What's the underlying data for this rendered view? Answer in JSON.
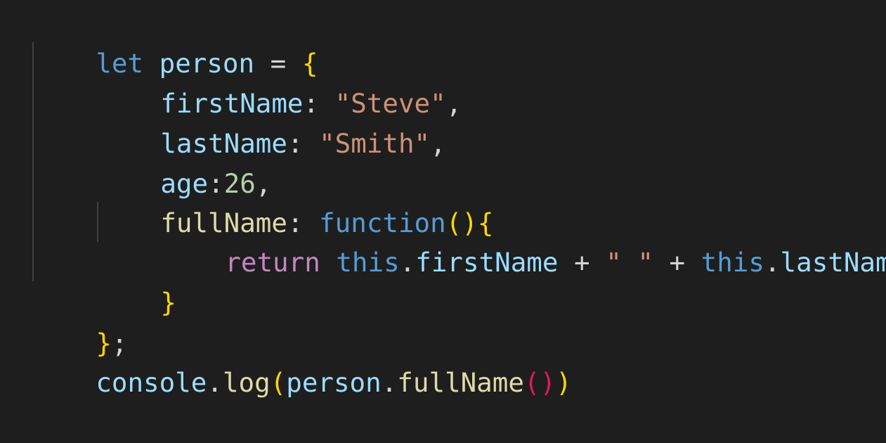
{
  "colors": {
    "background": "#1e1e1e",
    "keyword": "#569cd6",
    "variable": "#9cdcfe",
    "operator": "#d4d4d4",
    "string": "#ce9178",
    "number": "#b5cea8",
    "control": "#c586c0",
    "function": "#dcdcaa",
    "bracket_gold": "#ffd700",
    "bracket_pink": "#d81b60"
  },
  "code": {
    "line1": {
      "kw": "let",
      "sp": " ",
      "var": "person",
      "op": " = ",
      "brace": "{"
    },
    "line2": {
      "prop": "firstName",
      "colon": ": ",
      "str": "\"Steve\"",
      "comma": ","
    },
    "line3": {
      "prop": "lastName",
      "colon": ": ",
      "str": "\"Smith\"",
      "comma": ","
    },
    "line4": {
      "prop": "age",
      "colon": ":",
      "num": "26",
      "comma": ","
    },
    "line5": {
      "prop": "fullName",
      "colon": ": ",
      "kw": "function",
      "paren_open": "(",
      "paren_close": ")",
      "brace": "{"
    },
    "line6": {
      "ret": "return",
      "sp1": " ",
      "this1": "this",
      "dot1": ".",
      "prop1": "firstName",
      "op1": " + ",
      "str": "\" \"",
      "op2": " + ",
      "this2": "this",
      "dot2": ".",
      "prop2": "lastName"
    },
    "line7": {
      "brace": "}"
    },
    "line8": {
      "brace": "}",
      "semi": ";"
    },
    "line9": {
      "obj": "console",
      "dot1": ".",
      "method": "log",
      "paren_open": "(",
      "var": "person",
      "dot2": ".",
      "fn": "fullName",
      "call_open": "(",
      "call_close": ")",
      "paren_close": ")"
    }
  }
}
